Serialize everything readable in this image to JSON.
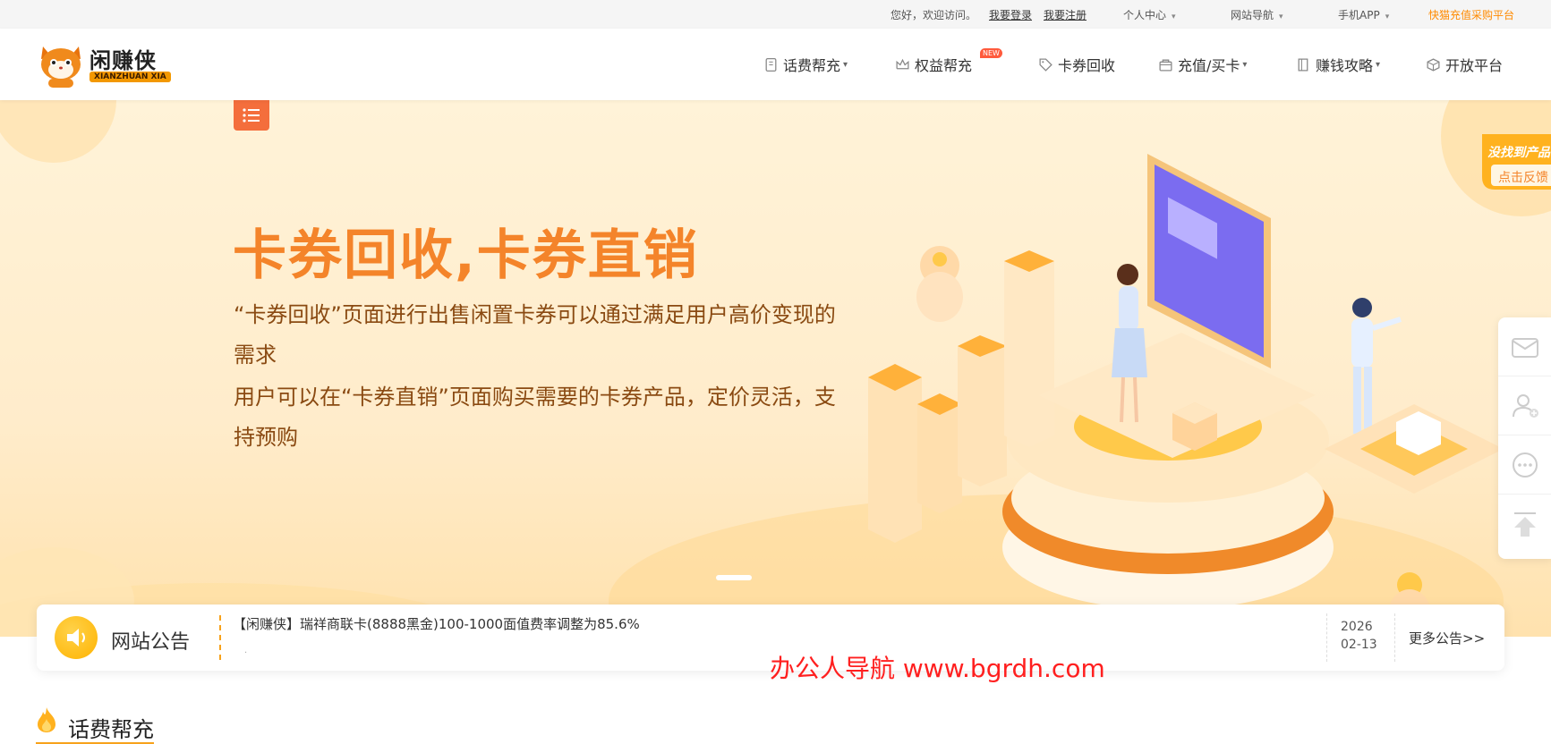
{
  "topbar": {
    "greeting": "您好，欢迎访问。",
    "login": "我要登录",
    "register": "我要注册",
    "personal_center": "个人中心",
    "site_nav": "网站导航",
    "mobile_app": "手机APP",
    "platform": "快猫充值采购平台"
  },
  "logo": {
    "name": "闲赚侠",
    "subtitle": "XIANZHUAN XIA"
  },
  "nav": [
    {
      "label": "话费帮充",
      "icon": "phone-bill-icon",
      "dropdown": true
    },
    {
      "label": "权益帮充",
      "icon": "crown-icon",
      "dropdown": false,
      "badge": "NEW"
    },
    {
      "label": "卡券回收",
      "icon": "tag-icon",
      "dropdown": false
    },
    {
      "label": "充值/买卡",
      "icon": "bag-icon",
      "dropdown": true
    },
    {
      "label": "赚钱攻略",
      "icon": "book-icon",
      "dropdown": true
    },
    {
      "label": "开放平台",
      "icon": "cube-icon",
      "dropdown": false
    }
  ],
  "hero": {
    "title": "卡券回收,卡券直销",
    "para1": "“卡券回收”页面进行出售闲置卡券可以通过满足用户高价变现的需求",
    "para2": "用户可以在“卡券直销”页面购买需要的卡券产品，定价灵活，支持预购"
  },
  "side_feedback": {
    "line1": "没找到产品",
    "button": "点击反馈"
  },
  "side_bar": [
    "mail-icon",
    "user-add-icon",
    "chat-icon",
    "back-to-top-icon"
  ],
  "notice": {
    "label": "网站公告",
    "message": "【闲赚侠】瑞祥商联卡(8888黑金)100-1000面值费率调整为85.6%",
    "year": "2026",
    "date": "02-13",
    "more": "更多公告>>"
  },
  "watermark": "办公人导航  www.bgrdh.com",
  "section": {
    "title": "话费帮充"
  },
  "colors": {
    "accent": "#f4842a",
    "brand_orange": "#ff8a00",
    "hero_bg": "#ffeccb",
    "notice_dash": "#f7a21b"
  }
}
